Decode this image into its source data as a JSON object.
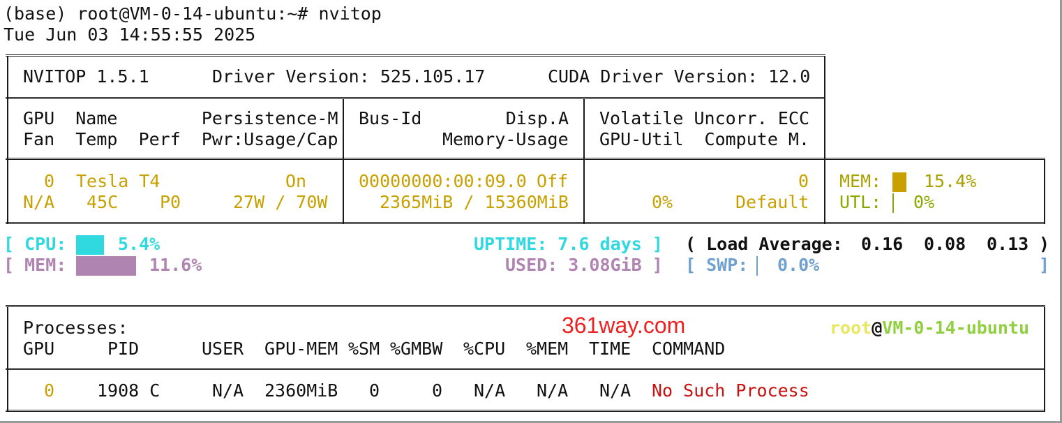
{
  "terminal": {
    "prompt": "(base) root@VM-0-14-ubuntu:~# nvitop",
    "timestamp": "Tue Jun 03 14:55:55 2025"
  },
  "header": {
    "title": "NVITOP 1.5.1",
    "driver": "Driver Version: 525.105.17",
    "cuda": "CUDA Driver Version: 12.0"
  },
  "columns": {
    "c1_r1": "GPU  Name        Persistence-M",
    "c1_r2": "Fan  Temp  Perf  Pwr:Usage/Cap",
    "c2_r1": "Bus-Id        Disp.A",
    "c2_r2": "Memory-Usage",
    "c3_r1": "Volatile Uncorr. ECC",
    "c3_r2": "GPU-Util  Compute M."
  },
  "gpu": {
    "index": "0",
    "name": "Tesla T4",
    "persistence": "On",
    "fan": "N/A",
    "temp": "45C",
    "perf": "P0",
    "power": "27W / 70W",
    "bus_id": "00000000:00:09.0",
    "disp": "Off",
    "memory_usage": "2365MiB / 15360MiB",
    "ecc": "0",
    "util": "0%",
    "compute_mode": "Default",
    "mem_label": "MEM:",
    "mem_pct": "15.4%",
    "mem_fraction": 0.154,
    "utl_label": "UTL:",
    "utl_pct": "0%",
    "utl_fraction": 0.0
  },
  "host": {
    "cpu_open": "[ CPU:",
    "cpu_pct": "5.4%",
    "cpu_fraction": 0.054,
    "uptime": "UPTIME: 7.6 days ]",
    "load_label": "( Load Average:",
    "load_1": "0.16",
    "load_5": "0.08",
    "load_15": "0.13",
    "load_close": ")",
    "mem_open": "[ MEM:",
    "mem_pct": "11.6%",
    "mem_fraction": 0.116,
    "used": "USED: 3.08GiB ]",
    "swp_open": "[ SWP:",
    "swp_pct": "0.0%",
    "swp_fraction": 0.0,
    "swp_close": "]",
    "colors": {
      "cpu": "#30d8e0",
      "mem": "#b084b0",
      "swp": "#6fa0d0",
      "gpu_mem": "#c8a000"
    }
  },
  "processes": {
    "title": "Processes:",
    "watermark": "361way.com",
    "user": "root",
    "at": "@",
    "host": "VM-0-14-ubuntu",
    "headers": {
      "gpu": "GPU",
      "pid": "PID",
      "user": "USER",
      "gpu_mem": "GPU-MEM",
      "sm": "%SM",
      "gmbw": "%GMBW",
      "cpu": "%CPU",
      "mem": "%MEM",
      "time": "TIME",
      "command": "COMMAND"
    },
    "rows": [
      {
        "gpu": "0",
        "pid": "1908 C",
        "user": "N/A",
        "gpu_mem": "2360MiB",
        "sm": "0",
        "gmbw": "0",
        "cpu": "N/A",
        "mem": "N/A",
        "time": "N/A",
        "command": "No Such Process"
      }
    ]
  }
}
